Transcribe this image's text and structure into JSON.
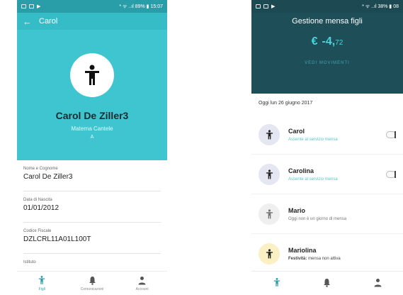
{
  "left": {
    "status": {
      "right": "* ᯤ ..ıl 89% ▮ 15:07"
    },
    "appbar": {
      "back_icon": "arrow-back-icon",
      "title": "Carol"
    },
    "hero": {
      "icon": "child-icon",
      "name": "Carol De Ziller3",
      "school": "Materna Cantele",
      "section": "A"
    },
    "fields": [
      {
        "label": "Nome e Cognome",
        "value": "Carol De Ziller3"
      },
      {
        "label": "Data di Nascita",
        "value": "01/01/2012"
      },
      {
        "label": "Codice Fiscale",
        "value": "DZLCRL11A01L100T"
      },
      {
        "label": "Istituto",
        "value": ""
      }
    ],
    "nav": [
      {
        "label": "Figli",
        "icon": "child-icon"
      },
      {
        "label": "Comunicazioni",
        "icon": "bell-icon"
      },
      {
        "label": "Account",
        "icon": "person-icon"
      }
    ]
  },
  "right": {
    "status": {
      "right": "* ᯤ ..ıl 38% ▮ 08"
    },
    "header": {
      "title": "Gestione mensa figli",
      "currency": "€",
      "amount_main": "-4,",
      "amount_cents": "72",
      "link": "VEDI MOVIMENTI"
    },
    "date": "Oggi lun 26 giugno 2017",
    "kids": [
      {
        "name": "Carol",
        "status": "Assente al servizio mensa",
        "avatar_bg": "#e4e6f1",
        "status_color": "teal",
        "toggle": true
      },
      {
        "name": "Carolina",
        "status": "Assente al servizio mensa",
        "avatar_bg": "#e4e6f1",
        "status_color": "teal",
        "toggle": true
      },
      {
        "name": "Mario",
        "status": "Oggi non è un giorno di mensa",
        "avatar_bg": "#efefef",
        "status_color": "grey",
        "toggle": false
      },
      {
        "name": "Mariolina",
        "status_label": "Festività:",
        "status": "mensa non attiva",
        "avatar_bg": "#fbefc4",
        "status_color": "dark",
        "toggle": false
      }
    ],
    "nav": [
      {
        "icon": "child-icon"
      },
      {
        "icon": "bell-icon"
      },
      {
        "icon": "person-icon"
      }
    ]
  },
  "colors": {
    "teal": "#3fc5cf",
    "dark_teal": "#1e4e57",
    "accent": "#4fd2dc"
  }
}
